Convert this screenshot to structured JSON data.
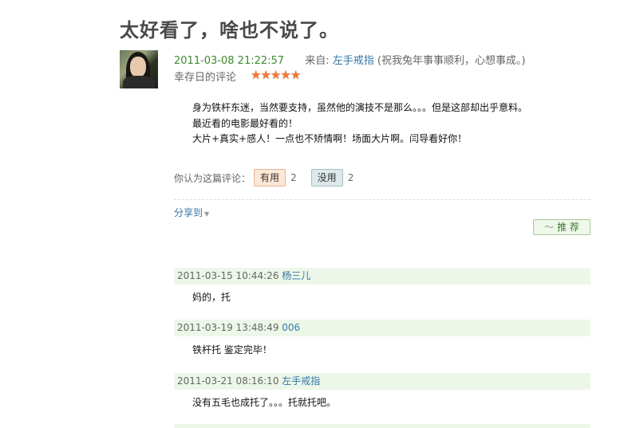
{
  "review": {
    "title": "太好看了，啥也不说了。",
    "date": "2011-03-08 21:22:57",
    "from_label": "来自:",
    "author": "左手戒指",
    "signature": "(祝我兔年事事顺利，心想事成。)",
    "review_of": "幸存日的评论",
    "rating_stars": 5,
    "stars": [
      "★",
      "★",
      "★",
      "★",
      "★"
    ],
    "body_lines": [
      "身为铁杆东迷，当然要支持，虽然他的演技不是那么。。。但是这部却出乎意料。",
      "最近看的电影最好看的！",
      "大片+真实+感人！一点也不矫情啊！场面大片啊。闫导看好你！"
    ]
  },
  "vote": {
    "prompt": "你认为这篇评论：",
    "useful_label": "有用",
    "useful_count": "2",
    "useless_label": "没用",
    "useless_count": "2"
  },
  "share": {
    "label": "分享到",
    "caret": "▼"
  },
  "recommend": {
    "wave": "～",
    "label": "推 荐"
  },
  "comments": [
    {
      "time": "2011-03-15 10:44:26",
      "user": "杨三儿",
      "text": "妈的，托"
    },
    {
      "time": "2011-03-19 13:48:49",
      "user": "006",
      "text": "铁杆托 鉴定完毕！"
    },
    {
      "time": "2011-03-21 08:16:10",
      "user": "左手戒指",
      "text": "没有五毛也成托了。。。托就托吧。"
    }
  ],
  "colors": {
    "title": "#494949",
    "date_green": "#3d8a2c",
    "link_blue": "#3377aa",
    "star_orange": "#f07a3c",
    "comment_bg": "#edf7e9"
  }
}
